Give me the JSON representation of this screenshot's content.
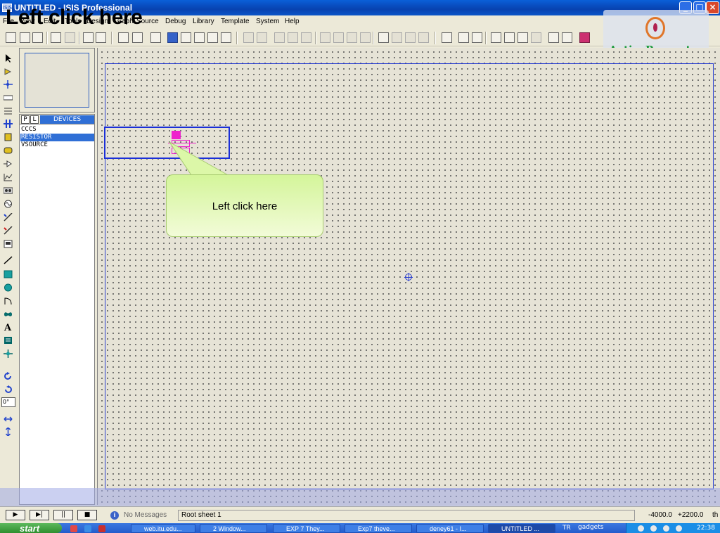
{
  "window": {
    "title": "UNTITLED - ISIS Professional",
    "app_icon_label": "ISIS",
    "buttons": {
      "minimize": "_",
      "maximize": "□",
      "close": "×"
    }
  },
  "overlay_caption": "Left click here",
  "menu": {
    "items": [
      "File",
      "View",
      "Edit",
      "Tools",
      "Design",
      "Graph",
      "Source",
      "Debug",
      "Library",
      "Template",
      "System",
      "Help"
    ]
  },
  "watermark": {
    "text": "ActivePresenter"
  },
  "device_selector": {
    "tab_p": "P",
    "tab_l": "L",
    "title": "DEVICES",
    "items": [
      "CCCS",
      "RESISTOR",
      "VSOURCE"
    ],
    "selected_index": 1
  },
  "rotation_field": {
    "value": "0°"
  },
  "callout": {
    "text": "Left click here"
  },
  "statusbar": {
    "sim_buttons": [
      "▶",
      "▶|",
      "||",
      "■"
    ],
    "info_icon": "i",
    "message": "No Messages",
    "sheet": "Root sheet 1",
    "coord_x": "-4000.0",
    "coord_y": "+2200.0",
    "unit": "th"
  },
  "taskbar": {
    "start": "start",
    "tasks": [
      "web.itu.edu...",
      "2 Window...",
      "EXP 7 They...",
      "Exp7 theve...",
      "deney61 - I...",
      "UNTITLED ..."
    ],
    "active_task": 5,
    "language": "TR",
    "extra": "gadgets",
    "clock": "22:38"
  },
  "colors": {
    "titlebar": "#0842b0",
    "selection_highlight": "#2f6fd6",
    "component": "#ee22cc",
    "callout": "#d4f59a",
    "watermark_text": "#1e9a3c"
  }
}
